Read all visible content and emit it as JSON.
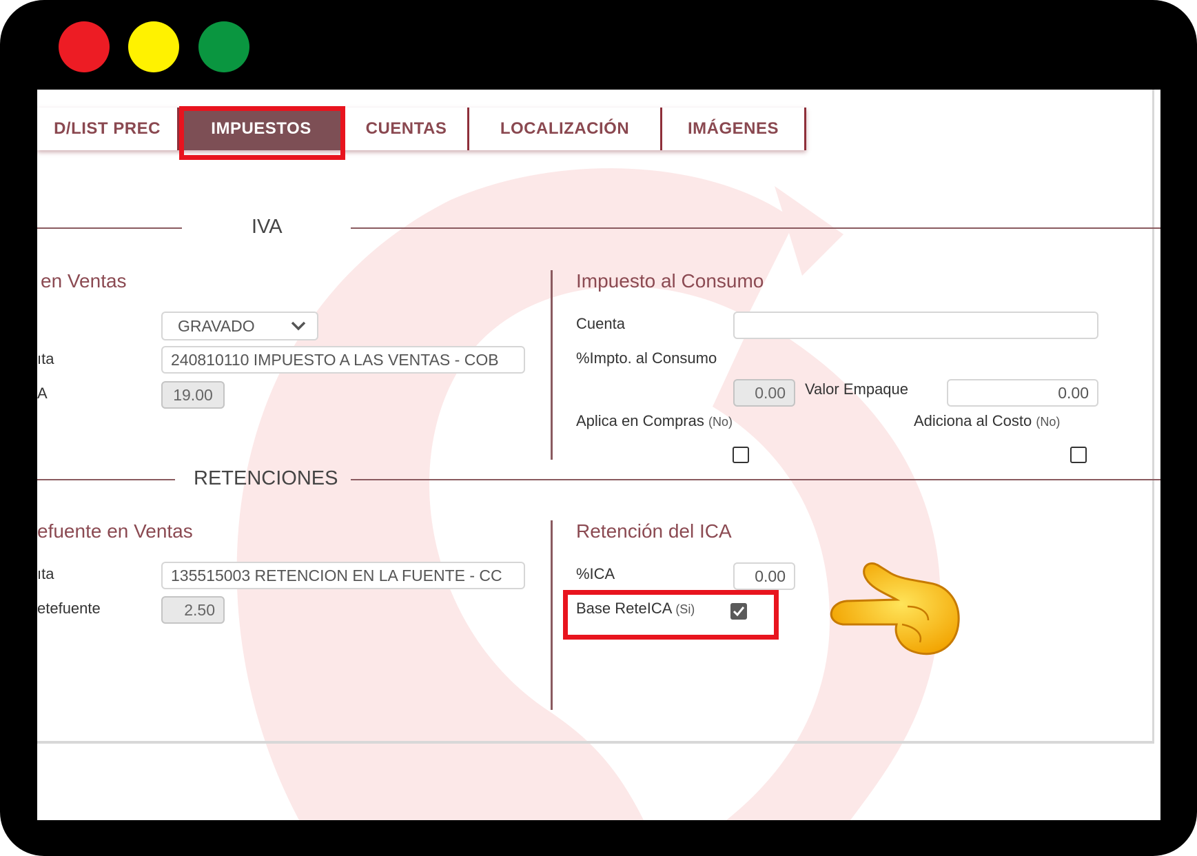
{
  "tabs": [
    {
      "label": "D/LIST PREC",
      "active": false
    },
    {
      "label": "IMPUESTOS",
      "active": true
    },
    {
      "label": "CUENTAS",
      "active": false
    },
    {
      "label": "LOCALIZACIÓN",
      "active": false
    },
    {
      "label": "IMÁGENES",
      "active": false
    }
  ],
  "iva": {
    "section_title": "IVA",
    "ventas": {
      "title": "en Ventas",
      "type_value": "GRAVADO",
      "cuenta_label": "ıta",
      "cuenta_value": "240810110 IMPUESTO A LAS VENTAS - COB",
      "pct_label": "A",
      "pct_value": "19.00"
    },
    "consumo": {
      "title": "Impuesto al Consumo",
      "cuenta_label": "Cuenta",
      "cuenta_value": "",
      "pct_label": "%Impto. al Consumo",
      "pct_value": "0.00",
      "empaque_label": "Valor Empaque",
      "empaque_value": "0.00",
      "compras_label": "Aplica en Compras",
      "compras_state": "(No)",
      "compras_checked": false,
      "costo_label": "Adiciona al Costo",
      "costo_state": "(No)",
      "costo_checked": false
    }
  },
  "retenciones": {
    "section_title": "RETENCIONES",
    "retefuente": {
      "title": "efuente en Ventas",
      "cuenta_label": "ıta",
      "cuenta_value": "135515003 RETENCION EN LA FUENTE - CC",
      "pct_label": "etefuente",
      "pct_value": "2.50"
    },
    "ica": {
      "title": "Retención del ICA",
      "pct_label": "%ICA",
      "pct_value": "0.00",
      "base_label": "Base ReteICA",
      "base_state": "(Si)",
      "base_checked": true
    }
  },
  "colors": {
    "highlight": "#e8141e",
    "accent": "#8b4a52",
    "active_tab": "#7d4f55"
  },
  "icons": {
    "pointer": "pointing-hand-icon",
    "select": "chevron-down-icon"
  }
}
